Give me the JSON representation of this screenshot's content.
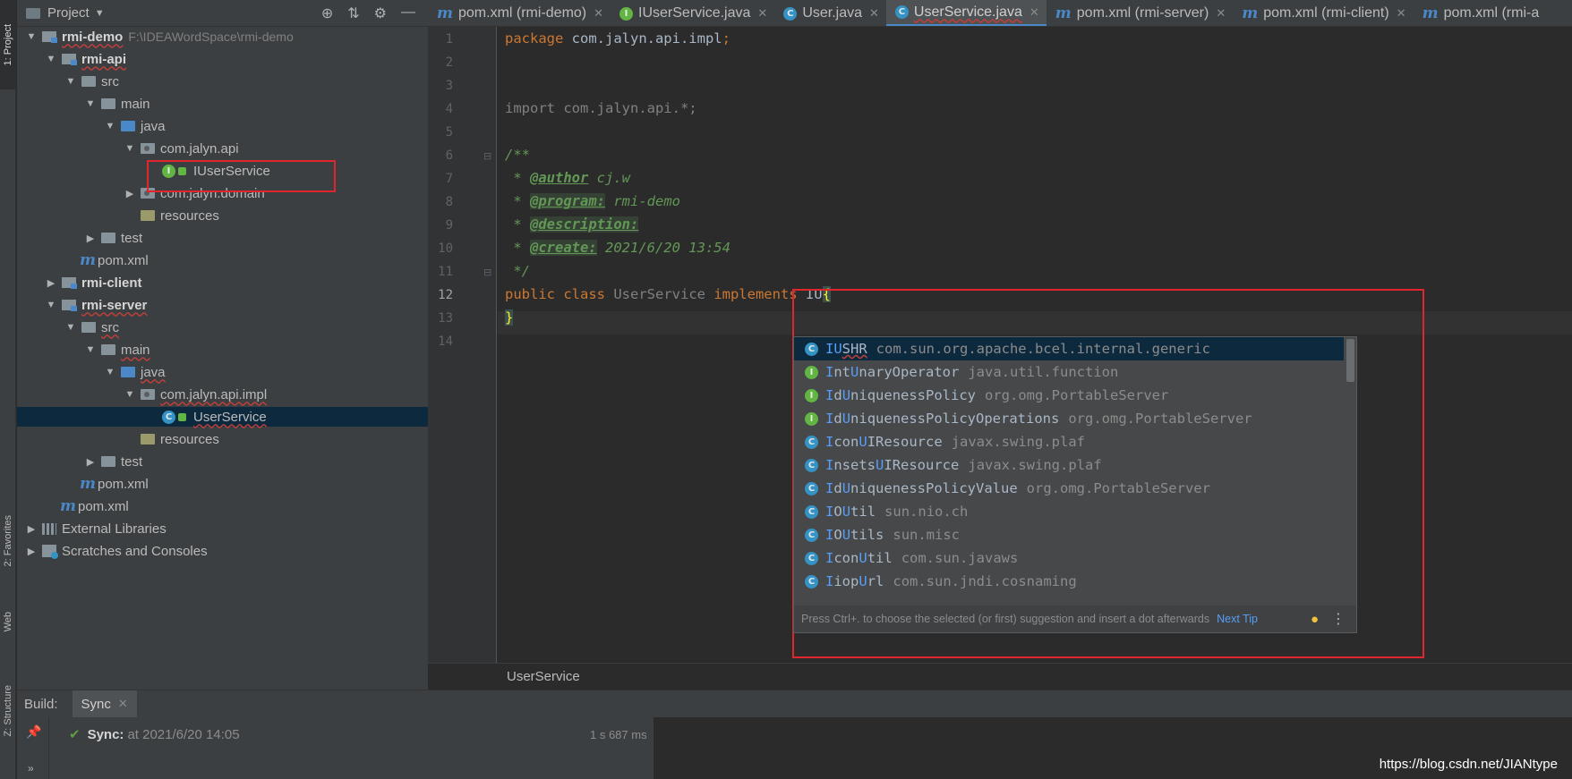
{
  "side_tabs": {
    "project": "1: Project",
    "favorites": "2: Favorites",
    "web": "Web",
    "structure": "Z: Structure"
  },
  "project_panel": {
    "title": "Project",
    "tree": [
      {
        "label": "rmi-demo",
        "path": "F:\\IDEAWordSpace\\rmi-demo"
      },
      {
        "label": "rmi-api"
      },
      {
        "label": "src"
      },
      {
        "label": "main"
      },
      {
        "label": "java"
      },
      {
        "label": "com.jalyn.api"
      },
      {
        "label": "IUserService"
      },
      {
        "label": "com.jalyn.domain"
      },
      {
        "label": "resources"
      },
      {
        "label": "test"
      },
      {
        "label": "pom.xml"
      },
      {
        "label": "rmi-client"
      },
      {
        "label": "rmi-server"
      },
      {
        "label": "src"
      },
      {
        "label": "main"
      },
      {
        "label": "java"
      },
      {
        "label": "com.jalyn.api.impl"
      },
      {
        "label": "UserService"
      },
      {
        "label": "resources"
      },
      {
        "label": "test"
      },
      {
        "label": "pom.xml"
      },
      {
        "label": "pom.xml"
      },
      {
        "label": "External Libraries"
      },
      {
        "label": "Scratches and Consoles"
      }
    ]
  },
  "tabs": [
    {
      "label": "pom.xml (rmi-demo)"
    },
    {
      "label": "IUserService.java"
    },
    {
      "label": "User.java"
    },
    {
      "label": "UserService.java"
    },
    {
      "label": "pom.xml (rmi-server)"
    },
    {
      "label": "pom.xml (rmi-client)"
    },
    {
      "label": "pom.xml (rmi-a"
    }
  ],
  "editor": {
    "line_numbers": [
      "1",
      "2",
      "3",
      "4",
      "5",
      "6",
      "7",
      "8",
      "9",
      "10",
      "11",
      "12",
      "13",
      "14"
    ],
    "code": {
      "l1_kw": "package",
      "l1_rest": " com.jalyn.api.impl",
      "l1_semi": ";",
      "l4": "import com.jalyn.api.*;",
      "l6": "/**",
      "l7_pre": " * ",
      "l7_tag": "@author",
      "l7_val": " cj.w",
      "l8_pre": " * ",
      "l8_tag": "@program:",
      "l8_val": " rmi-demo",
      "l9_pre": " * ",
      "l9_tag": "@description:",
      "l10_pre": " * ",
      "l10_tag": "@create:",
      "l10_val": " 2021/6/20 13:54",
      "l11": " */",
      "l12_kw1": "public class ",
      "l12_name": "UserService",
      "l12_kw2": " implements ",
      "l12_typed": "IU",
      "l12_brace": "{",
      "l13": "}"
    },
    "breadcrumb": "UserService"
  },
  "autocomplete": {
    "items": [
      {
        "kind": "C",
        "name_match": "IU",
        "name_rest": "SHR",
        "pkg": "com.sun.org.apache.bcel.internal.generic"
      },
      {
        "kind": "I",
        "name_match": "I",
        "name_mid": "nt",
        "name_match2": "U",
        "name_rest": "naryOperator",
        "pkg": "java.util.function"
      },
      {
        "kind": "I",
        "name_match": "I",
        "name_mid": "d",
        "name_match2": "U",
        "name_rest": "niquenessPolicy",
        "pkg": "org.omg.PortableServer"
      },
      {
        "kind": "I",
        "name_match": "I",
        "name_mid": "d",
        "name_match2": "U",
        "name_rest": "niquenessPolicyOperations",
        "pkg": "org.omg.PortableServer"
      },
      {
        "kind": "C",
        "name_match": "I",
        "name_mid": "con",
        "name_match2": "U",
        "name_rest": "IResource",
        "pkg": "javax.swing.plaf"
      },
      {
        "kind": "C",
        "name_match": "I",
        "name_mid": "nsets",
        "name_match2": "U",
        "name_rest": "IResource",
        "pkg": "javax.swing.plaf"
      },
      {
        "kind": "C",
        "name_match": "I",
        "name_mid": "d",
        "name_match2": "U",
        "name_rest": "niquenessPolicyValue",
        "pkg": "org.omg.PortableServer"
      },
      {
        "kind": "C",
        "name_match": "I",
        "name_mid": "O",
        "name_match2": "U",
        "name_rest": "til",
        "pkg": "sun.nio.ch"
      },
      {
        "kind": "C",
        "name_match": "I",
        "name_mid": "O",
        "name_match2": "U",
        "name_rest": "tils",
        "pkg": "sun.misc"
      },
      {
        "kind": "C",
        "name_match": "I",
        "name_mid": "con",
        "name_match2": "U",
        "name_rest": "til",
        "pkg": "com.sun.javaws"
      },
      {
        "kind": "C",
        "name_match": "I",
        "name_mid": "iop",
        "name_match2": "U",
        "name_rest": "rl",
        "pkg": "com.sun.jndi.cosnaming"
      }
    ],
    "footer_text": "Press Ctrl+. to choose the selected (or first) suggestion and insert a dot afterwards",
    "footer_tip": "Next Tip"
  },
  "build": {
    "label": "Build:",
    "tab": "Sync",
    "status_key": "Sync:",
    "status_at": "at 2021/6/20 14:05",
    "duration": "1 s 687 ms"
  },
  "watermark": "https://blog.csdn.net/JIANtype",
  "colors": {
    "accent": "#4a88c7",
    "highlight_box": "#e0262c",
    "selection": "#0d293e"
  }
}
